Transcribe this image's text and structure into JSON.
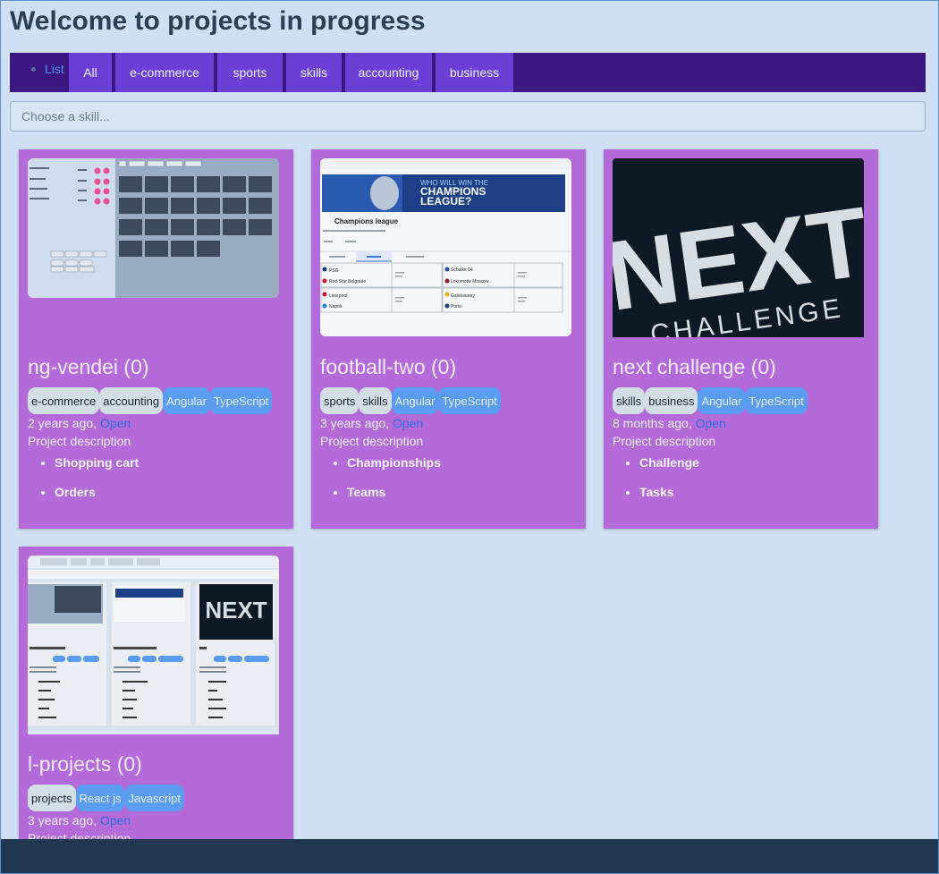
{
  "header": {
    "title": "Welcome to projects in progress"
  },
  "nav": {
    "list_label": "List",
    "tabs": [
      "All",
      "e-commerce",
      "sports",
      "skills",
      "accounting",
      "business"
    ]
  },
  "search": {
    "placeholder": "Choose a skill..."
  },
  "projects": [
    {
      "title": "ng-vendei (0)",
      "categories": [
        "e-commerce",
        "accounting"
      ],
      "techs": [
        "Angular",
        "TypeScript"
      ],
      "age": "2 years ago,",
      "open_label": "Open",
      "description": "Project description",
      "features": [
        "Shopping cart",
        "Orders"
      ]
    },
    {
      "title": "football-two (0)",
      "categories": [
        "sports",
        "skills"
      ],
      "techs": [
        "Angular",
        "TypeScript"
      ],
      "age": "3 years ago,",
      "open_label": "Open",
      "description": "Project description",
      "features": [
        "Championships",
        "Teams"
      ],
      "thumb_text": {
        "banner_line1": "WHO WILL WIN THE",
        "banner_line2": "CHAMPIONS",
        "banner_line3": "LEAGUE?",
        "heading": "Champions league",
        "teams": [
          "PSG",
          "Red Star Belgrade",
          "Schalke 04",
          "Lokomotiv Moscow",
          "Liverpool",
          "Napoli",
          "Galatasaray",
          "Porto"
        ]
      }
    },
    {
      "title": "next challenge (0)",
      "categories": [
        "skills",
        "business"
      ],
      "techs": [
        "Angular",
        "TypeScript"
      ],
      "age": "8 months ago,",
      "open_label": "Open",
      "description": "Project description",
      "features": [
        "Challenge",
        "Tasks"
      ],
      "thumb_text": {
        "logo": "NEXT",
        "logo_sub": "CHALLENGE"
      }
    },
    {
      "title": "l-projects (0)",
      "categories": [
        "projects"
      ],
      "techs": [
        "React js",
        "Javascript"
      ],
      "age": "3 years ago,",
      "open_label": "Open",
      "description": "Project description",
      "features": []
    }
  ],
  "colors": {
    "page_bg": "#cfe0f4",
    "navbar": "#3c1782",
    "tab": "#6b3fd6",
    "card": "#b46ad8",
    "category_tag": "#d3dde6",
    "tech_tag": "#5a9cf0",
    "link": "#2e6fe0",
    "footer": "#213651"
  }
}
